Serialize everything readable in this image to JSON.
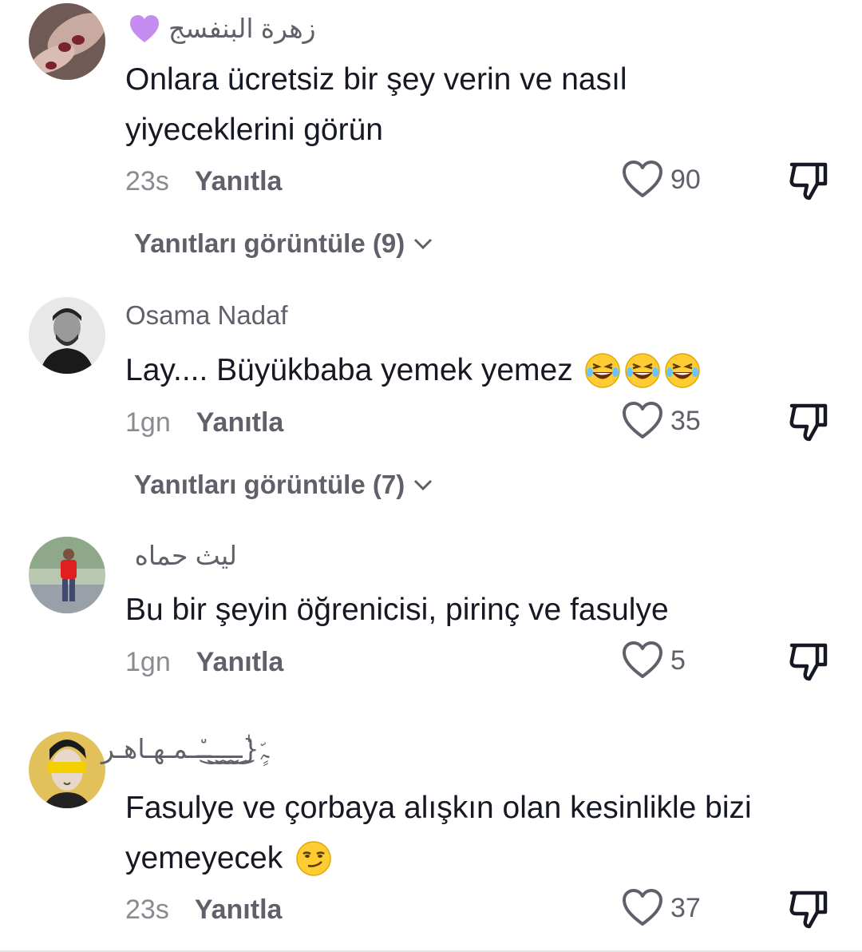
{
  "comments": [
    {
      "username": "زهرة البنفسج",
      "text_line1": "Onlara ücretsiz bir şey verin ve nasıl",
      "text_line2": "yiyeceklerini görün",
      "time": "23s",
      "reply_label": "Yanıtla",
      "likes": "90",
      "view_replies": "Yanıtları görüntüle (9)"
    },
    {
      "username": "Osama Nadaf",
      "text": "Lay.... Büyükbaba yemek yemez",
      "time": "1gn",
      "reply_label": "Yanıtla",
      "likes": "35",
      "view_replies": "Yanıtları görüntüle (7)"
    },
    {
      "username": "ليث حماه",
      "text": "Bu bir şeyin öğrenicisi, pirinç ve fasulye",
      "time": "1gn",
      "reply_label": "Yanıtla",
      "likes": "5"
    },
    {
      "username": "ﮧٍّ{ٰ͜ـ͜ـ͜ـ͜ـ͜ـ٘ـمـهـاهـر",
      "text_line1": "Fasulye ve çorbaya alışkın olan kesinlikle bizi",
      "text_line2": "yemeyecek",
      "time": "23s",
      "reply_label": "Yanıtla",
      "likes": "37"
    }
  ],
  "colors": {
    "text_primary": "#161823",
    "text_secondary": "#5f6069",
    "text_muted": "#8a8b91",
    "purple_heart": "#c58cf2"
  }
}
